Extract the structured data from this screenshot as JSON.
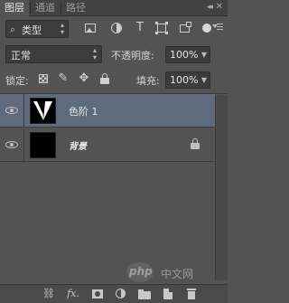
{
  "tabs": [
    {
      "label": "图层",
      "active": true
    },
    {
      "label": "通道",
      "active": false
    },
    {
      "label": "路径",
      "active": false
    }
  ],
  "filter": {
    "label": "类型",
    "icons": [
      "image-filter-icon",
      "adjustment-filter-icon",
      "type-filter-icon",
      "shape-filter-icon",
      "smart-object-filter-icon",
      "filter-toggle-icon"
    ]
  },
  "blend_mode": "正常",
  "opacity": {
    "label": "不透明度:",
    "value": "100%"
  },
  "lock": {
    "label": "锁定:",
    "icons": [
      "lock-transparent-icon",
      "lock-image-icon",
      "lock-position-icon",
      "lock-all-icon"
    ]
  },
  "fill": {
    "label": "填充:",
    "value": "100%"
  },
  "layers": [
    {
      "name": "色阶 1",
      "selected": true,
      "visible": true,
      "locked": false
    },
    {
      "name": "背景",
      "selected": false,
      "visible": true,
      "locked": true
    }
  ],
  "watermark": {
    "logo": "php",
    "text": "中文网"
  },
  "bottom_icons": [
    "link-layers-icon",
    "fx-icon",
    "layer-mask-icon",
    "new-adjustment-icon",
    "new-group-icon",
    "new-layer-icon",
    "delete-layer-icon"
  ],
  "colors": {
    "panel": "#535353",
    "selected": "#5d6b7d",
    "field": "#3c3c3c"
  }
}
